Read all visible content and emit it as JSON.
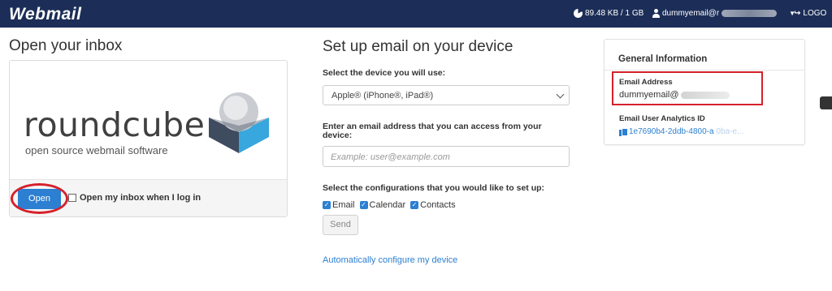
{
  "topbar": {
    "brand": "Webmail",
    "quota": "89.48 KB / 1 GB",
    "user": "dummyemail@r",
    "logout": "LOGO"
  },
  "open_inbox": {
    "title": "Open your inbox",
    "logo_word": "roundcube",
    "logo_sub": "open source webmail software",
    "open_button": "Open",
    "open_on_login_label": "Open my inbox when I log in",
    "open_on_login_checked": false
  },
  "setup": {
    "title": "Set up email on your device",
    "device_label": "Select the device you will use:",
    "device_selected": "Apple® (iPhone®, iPad®)",
    "email_label": "Enter an email address that you can access from your device:",
    "email_placeholder": "Example: user@example.com",
    "config_label": "Select the configurations that you would like to set up:",
    "configs": [
      {
        "label": "Email",
        "checked": true
      },
      {
        "label": "Calendar",
        "checked": true
      },
      {
        "label": "Contacts",
        "checked": true
      }
    ],
    "send_button": "Send",
    "auto_link": "Automatically configure my device"
  },
  "general_info": {
    "title": "General Information",
    "email_label": "Email Address",
    "email_value": "dummyemail@",
    "analytics_label": "Email User Analytics ID",
    "analytics_value": "1e7690b4-2ddb-4800-a",
    "analytics_faded": "0ba-e..."
  },
  "colors": {
    "topbar": "#1c2e57",
    "accent": "#2c7fd1",
    "highlight": "#d5212b"
  },
  "icons": {
    "quota": "pie-chart-icon",
    "user": "user-icon",
    "logout": "logout-icon",
    "copy": "copy-icon",
    "select": "chevron-down-icon"
  }
}
